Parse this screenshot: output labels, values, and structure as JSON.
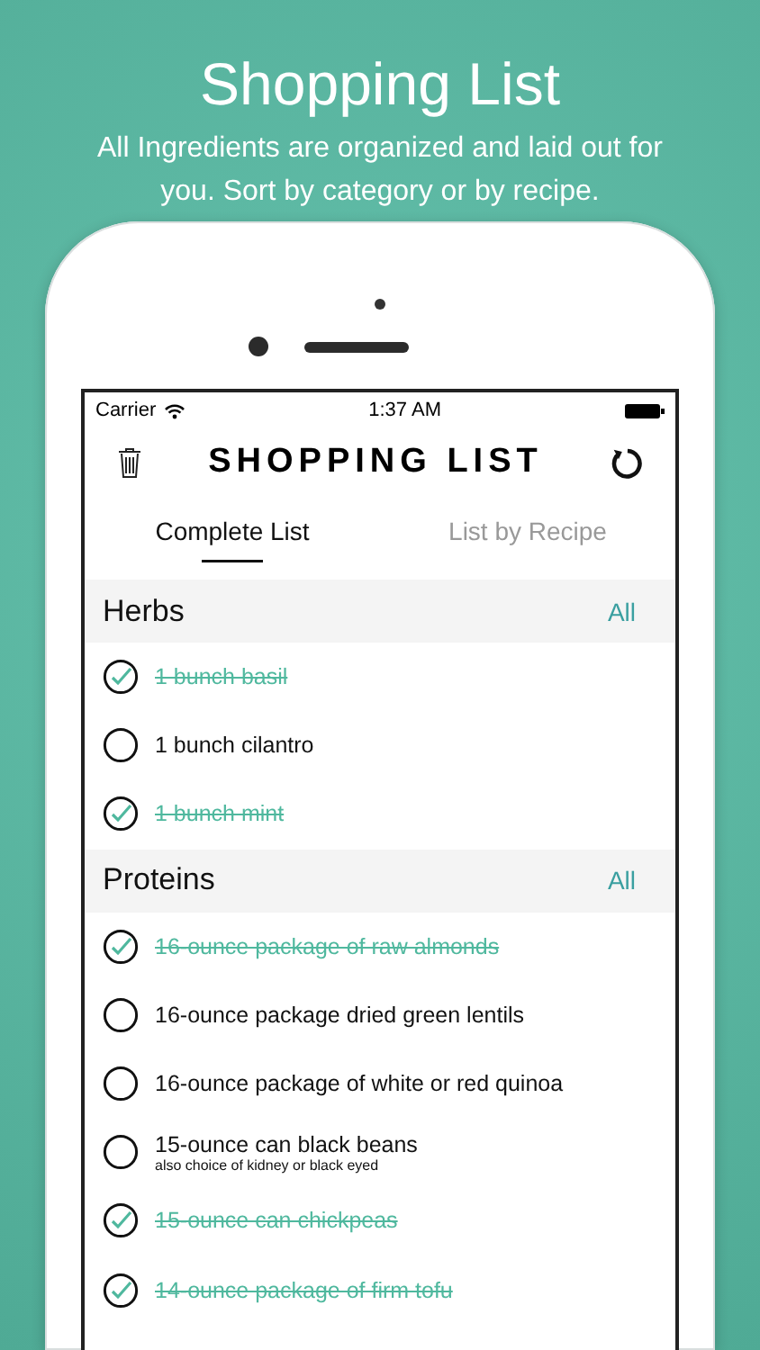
{
  "promo": {
    "title": "Shopping List",
    "subtitle": "All Ingredients are organized and laid out for you. Sort by category or by recipe."
  },
  "status_bar": {
    "carrier": "Carrier",
    "time": "1:37 AM"
  },
  "header": {
    "title": "SHOPPING LIST"
  },
  "tabs": [
    {
      "label": "Complete List",
      "selected": true
    },
    {
      "label": "List by Recipe",
      "selected": false
    }
  ],
  "sections": [
    {
      "name": "Herbs",
      "action": "All",
      "items": [
        {
          "name": "1 bunch basil",
          "checked": true
        },
        {
          "name": "1 bunch cilantro",
          "checked": false
        },
        {
          "name": "1 bunch mint",
          "checked": true
        }
      ]
    },
    {
      "name": "Proteins",
      "action": "All",
      "items": [
        {
          "name": "16-ounce package of raw almonds",
          "checked": true
        },
        {
          "name": "16-ounce package dried green lentils",
          "checked": false
        },
        {
          "name": "16-ounce package of white or red quinoa",
          "checked": false
        },
        {
          "name": "15-ounce can black beans",
          "note": "also choice of kidney or black eyed",
          "checked": false
        },
        {
          "name": "15-ounce can chickpeas",
          "checked": true
        },
        {
          "name": "14-ounce package of firm tofu",
          "checked": true
        }
      ]
    }
  ]
}
